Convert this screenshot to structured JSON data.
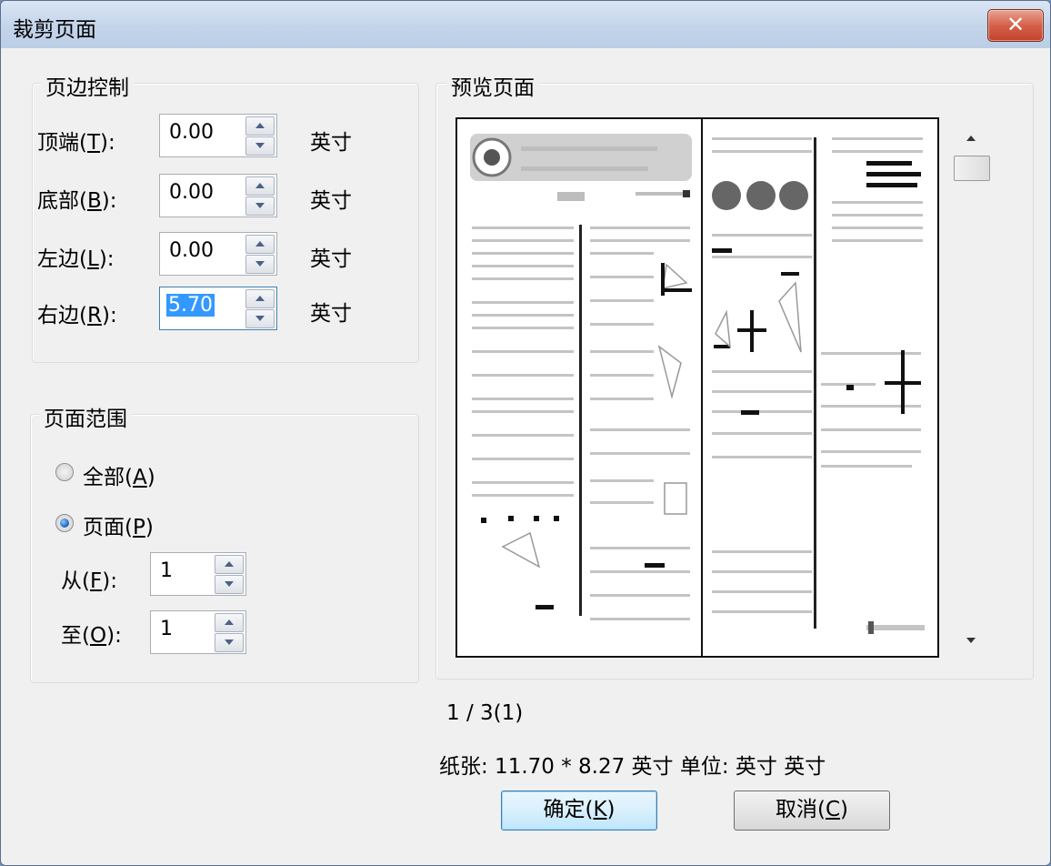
{
  "window": {
    "title": "裁剪页面",
    "close_glyph": "✕"
  },
  "margins": {
    "title": "页边控制",
    "fields": [
      {
        "label": "顶端(",
        "mnemonic": "T",
        "label_end": "):",
        "value": "0.00",
        "unit": "英寸"
      },
      {
        "label": "底部(",
        "mnemonic": "B",
        "label_end": "):",
        "value": "0.00",
        "unit": "英寸"
      },
      {
        "label": "左边(",
        "mnemonic": "L",
        "label_end": "):",
        "value": "0.00",
        "unit": "英寸"
      },
      {
        "label": "右边(",
        "mnemonic": "R",
        "label_end": "):",
        "value": "5.70",
        "unit": "英寸"
      }
    ]
  },
  "page_range": {
    "title": "页面范围",
    "all_label": "全部(",
    "all_mnemonic": "A",
    "all_end": ")",
    "page_label": "页面(",
    "page_mnemonic": "P",
    "page_end": ")",
    "selected": "page",
    "from_label": "从(",
    "from_mnemonic": "F",
    "from_end": "):",
    "from_value": "1",
    "to_label": "至(",
    "to_mnemonic": "O",
    "to_end": "):",
    "to_value": "1"
  },
  "preview": {
    "title": "预览页面",
    "page_indicator": "1 / 3(1)"
  },
  "paper_info": "纸张:  11.70 * 8.27 英寸 单位: 英寸 英寸",
  "buttons": {
    "ok": "确定(",
    "ok_mnemonic": "K",
    "ok_end": ")",
    "cancel": "取消(",
    "cancel_mnemonic": "C",
    "cancel_end": ")"
  }
}
